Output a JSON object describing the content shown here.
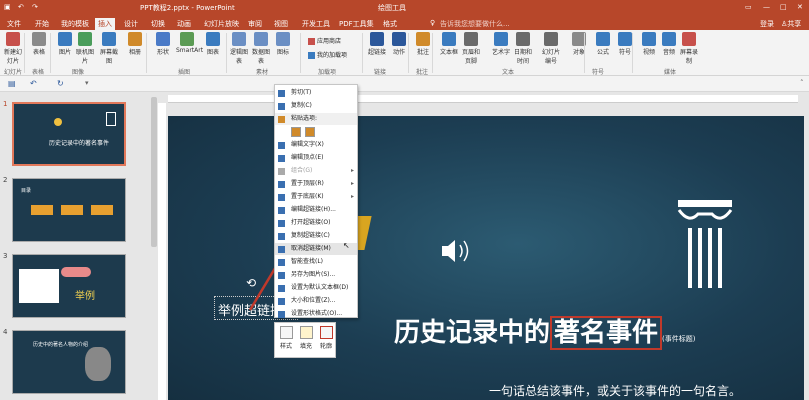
{
  "window": {
    "title": "PPT教程2.pptx - PowerPoint",
    "context_tool": "绘图工具",
    "login": "登录",
    "share": "共享"
  },
  "tabs": [
    "文件",
    "开始",
    "我的模板",
    "插入",
    "设计",
    "切换",
    "动画",
    "幻灯片放映",
    "审阅",
    "视图",
    "开发工具",
    "PDF工具集",
    "格式"
  ],
  "active_tab": "插入",
  "search_placeholder": "告诉我您想要做什么...",
  "ribbon": {
    "buttons": [
      "新建幻灯片",
      "表格",
      "图片",
      "联机图片",
      "屏幕截图",
      "相册",
      "形状",
      "SmartArt",
      "图表",
      "应用商店",
      "我的加载项",
      "超链接",
      "动作",
      "批注",
      "文本框",
      "页眉和页脚",
      "艺术字",
      "日期和时间",
      "幻灯片编号",
      "对象",
      "公式",
      "符号",
      "视频",
      "音频",
      "屏幕录制"
    ],
    "groups": [
      "幻灯片",
      "表格",
      "图像",
      "插图",
      "加载项",
      "链接",
      "批注",
      "文本",
      "符号",
      "媒体"
    ],
    "partial_buttons": [
      "逻辑图表",
      "数据图表",
      "图标"
    ],
    "group_素材": "素材"
  },
  "slides": {
    "numbers": [
      "1",
      "2",
      "3",
      "4"
    ],
    "thumb1_title": "历史记录中的著名事件",
    "thumb2_label": "目录",
    "thumb3_label": "举例",
    "thumb4_title": "历史中的著名人物的介绍"
  },
  "slide": {
    "title_pre": "历史记录中的",
    "title_box": "著名事件",
    "title_note": "(事件标题)",
    "subtitle": "一句话总结该事件，或关于该事件的一句名言。",
    "link_text": "举例超链接"
  },
  "context_menu": {
    "items": [
      {
        "label": "剪切(T)",
        "disabled": false
      },
      {
        "label": "复制(C)",
        "disabled": false
      },
      {
        "label": "粘贴选项:",
        "disabled": false,
        "header": true
      },
      {
        "label": "编辑文字(X)",
        "disabled": false
      },
      {
        "label": "编辑顶点(E)",
        "disabled": false
      },
      {
        "label": "组合(G)",
        "disabled": true,
        "arrow": true
      },
      {
        "label": "置于顶层(R)",
        "disabled": false,
        "arrow": true
      },
      {
        "label": "置于底层(K)",
        "disabled": false,
        "arrow": true
      },
      {
        "label": "编辑超链接(H)...",
        "disabled": false
      },
      {
        "label": "打开超链接(O)",
        "disabled": false
      },
      {
        "label": "复制超链接(C)",
        "disabled": false
      },
      {
        "label": "取消超链接(M)",
        "disabled": false,
        "highlight": true
      },
      {
        "label": "智能查找(L)",
        "disabled": false
      },
      {
        "label": "另存为图片(S)...",
        "disabled": false
      },
      {
        "label": "设置为默认文本框(D)",
        "disabled": false
      },
      {
        "label": "大小和位置(Z)...",
        "disabled": false
      },
      {
        "label": "设置形状格式(O)...",
        "disabled": false
      }
    ]
  },
  "mini_toolbar": [
    "样式",
    "填充",
    "轮廓"
  ],
  "colors": {
    "accent": "#b7472a",
    "slide_bg": "#1c3d52",
    "highlight_box": "#c0392b"
  }
}
